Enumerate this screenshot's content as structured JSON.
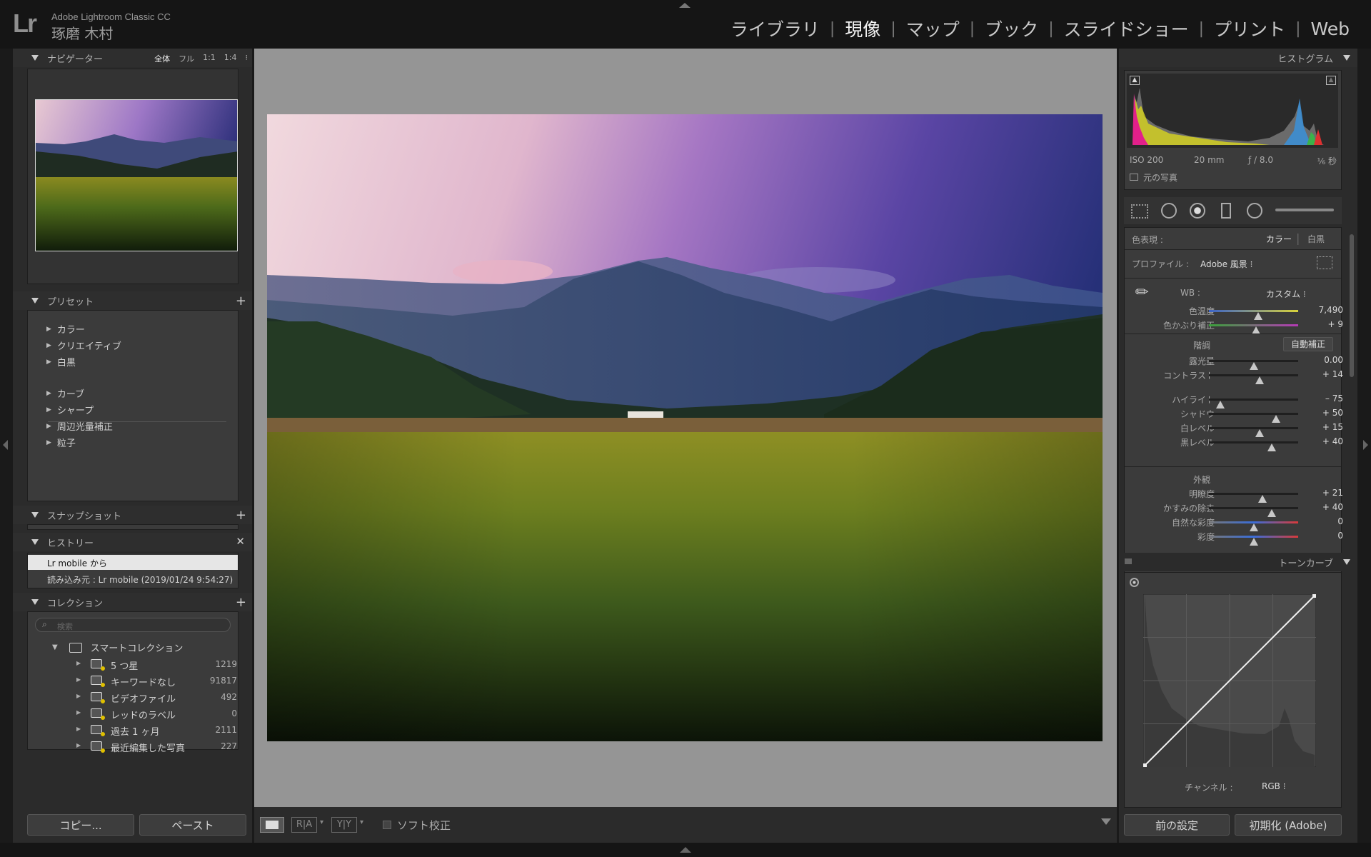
{
  "app": {
    "logo": "Lr",
    "name": "Adobe Lightroom Classic CC",
    "user": "琢磨 木村"
  },
  "modules": [
    {
      "label": "ライブラリ",
      "active": false
    },
    {
      "label": "現像",
      "active": true
    },
    {
      "label": "マップ",
      "active": false
    },
    {
      "label": "ブック",
      "active": false
    },
    {
      "label": "スライドショー",
      "active": false
    },
    {
      "label": "プリント",
      "active": false
    },
    {
      "label": "Web",
      "active": false
    }
  ],
  "navigator": {
    "title": "ナビゲーター",
    "zoom_options": [
      "全体",
      "フル",
      "1:1",
      "1:4"
    ]
  },
  "presets": {
    "title": "プリセット",
    "groups1": [
      "カラー",
      "クリエイティブ",
      "白黒"
    ],
    "groups2": [
      "カーブ",
      "シャープ",
      "周辺光量補正",
      "粒子"
    ]
  },
  "snapshots": {
    "title": "スナップショット"
  },
  "history": {
    "title": "ヒストリー",
    "items": [
      "Lr mobile から",
      "読み込み元 : Lr mobile (2019/01/24 9:54:27)"
    ]
  },
  "collections": {
    "title": "コレクション",
    "search_placeholder": "検索",
    "smart_label": "スマートコレクション",
    "items": [
      {
        "name": "5 つ星",
        "count": "1219"
      },
      {
        "name": "キーワードなし",
        "count": "91817"
      },
      {
        "name": "ビデオファイル",
        "count": "492"
      },
      {
        "name": "レッドのラベル",
        "count": "0"
      },
      {
        "name": "過去 1 ヶ月",
        "count": "2111"
      },
      {
        "name": "最近編集した写真",
        "count": "227"
      }
    ]
  },
  "left_buttons": {
    "copy": "コピー...",
    "paste": "ペースト"
  },
  "histogram": {
    "title": "ヒストグラム",
    "iso": "ISO 200",
    "focal": "20 mm",
    "aperture": "ƒ / 8.0",
    "shutter": "⅙ 秒",
    "original_label": "元の写真"
  },
  "treatment": {
    "label": "色表現 :",
    "color": "カラー",
    "bw": "白黒"
  },
  "profile": {
    "label": "プロファイル :",
    "value": "Adobe 風景"
  },
  "wb": {
    "label": "WB :",
    "value": "カスタム"
  },
  "sliders_wb": [
    {
      "label": "色温度",
      "value": "7,490",
      "pos": 0.55,
      "track": "temp"
    },
    {
      "label": "色かぶり補正",
      "value": "+ 9",
      "pos": 0.53,
      "track": "tint"
    }
  ],
  "tone": {
    "title": "階調",
    "auto": "自動補正"
  },
  "sliders_tone": [
    {
      "label": "露光量",
      "value": "0.00",
      "pos": 0.5
    },
    {
      "label": "コントラスト",
      "value": "+ 14",
      "pos": 0.57
    }
  ],
  "sliders_hl": [
    {
      "label": "ハイライト",
      "value": "– 75",
      "pos": 0.13
    },
    {
      "label": "シャドウ",
      "value": "+ 50",
      "pos": 0.75
    },
    {
      "label": "白レベル",
      "value": "+ 15",
      "pos": 0.57
    },
    {
      "label": "黒レベル",
      "value": "+ 40",
      "pos": 0.7
    }
  ],
  "presence": {
    "title": "外観"
  },
  "sliders_presence": [
    {
      "label": "明瞭度",
      "value": "+ 21",
      "pos": 0.6,
      "track": "gray"
    },
    {
      "label": "かすみの除去",
      "value": "+ 40",
      "pos": 0.7,
      "track": "gray"
    },
    {
      "label": "自然な彩度",
      "value": "0",
      "pos": 0.5,
      "track": "sat"
    },
    {
      "label": "彩度",
      "value": "0",
      "pos": 0.5,
      "track": "sat"
    }
  ],
  "tone_curve": {
    "title": "トーンカーブ",
    "channel_label": "チャンネル :",
    "channel": "RGB"
  },
  "right_buttons": {
    "previous": "前の設定",
    "reset": "初期化 (Adobe)"
  },
  "toolbar": {
    "soft_proof": "ソフト校正"
  },
  "colors": {
    "accent": "#e8e8e8",
    "panel": "#2b2b2b",
    "body": "#3b3b3b",
    "canvas": "#959595"
  }
}
